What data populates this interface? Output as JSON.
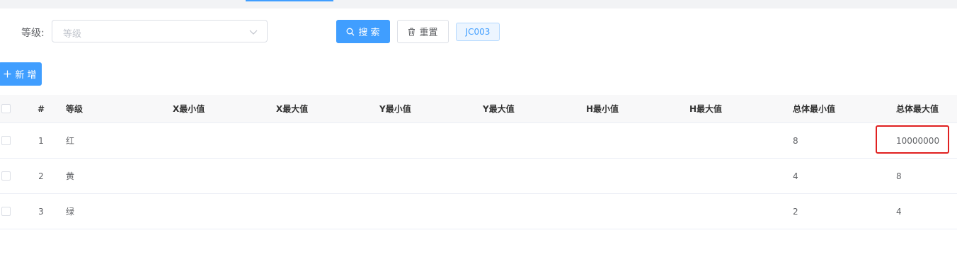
{
  "filter": {
    "level_label": "等级:",
    "level_placeholder": "等级"
  },
  "buttons": {
    "search": "搜 索",
    "reset": "重置",
    "tag": "JC003",
    "add": "新 增"
  },
  "table": {
    "headers": {
      "index": "#",
      "level": "等级",
      "x_min": "X最小值",
      "x_max": "X最大值",
      "y_min": "Y最小值",
      "y_max": "Y最大值",
      "h_min": "H最小值",
      "h_max": "H最大值",
      "total_min": "总体最小值",
      "total_max": "总体最大值"
    },
    "rows": [
      {
        "index": "1",
        "level": "红",
        "x_min": "",
        "x_max": "",
        "y_min": "",
        "y_max": "",
        "h_min": "",
        "h_max": "",
        "total_min": "8",
        "total_max": "10000000"
      },
      {
        "index": "2",
        "level": "黄",
        "x_min": "",
        "x_max": "",
        "y_min": "",
        "y_max": "",
        "h_min": "",
        "h_max": "",
        "total_min": "4",
        "total_max": "8"
      },
      {
        "index": "3",
        "level": "绿",
        "x_min": "",
        "x_max": "",
        "y_min": "",
        "y_max": "",
        "h_min": "",
        "h_max": "",
        "total_min": "2",
        "total_max": "4"
      }
    ]
  },
  "colors": {
    "primary": "#409eff",
    "highlight": "#e02020"
  },
  "icons": {
    "search": "search-icon",
    "reset": "trash-icon",
    "add": "plus-icon",
    "select": "chevron-down-icon"
  }
}
